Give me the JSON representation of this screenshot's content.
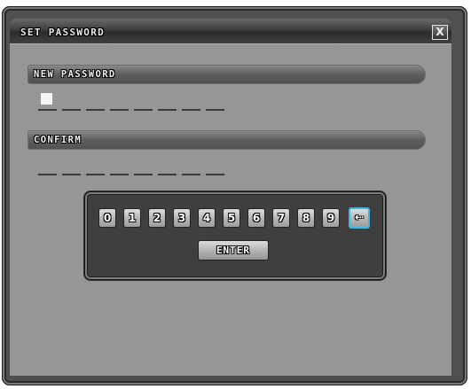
{
  "dialog": {
    "title": "SET PASSWORD",
    "close_label": "X"
  },
  "new_password": {
    "label": "NEW PASSWORD",
    "slot_count": 8
  },
  "confirm": {
    "label": "CONFIRM",
    "slot_count": 8
  },
  "keypad": {
    "keys": [
      "0",
      "1",
      "2",
      "3",
      "4",
      "5",
      "6",
      "7",
      "8",
      "9"
    ],
    "backspace_symbol": "⇠",
    "enter_label": "ENTER"
  },
  "colors": {
    "backspace_highlight": "#3fb8e0"
  }
}
